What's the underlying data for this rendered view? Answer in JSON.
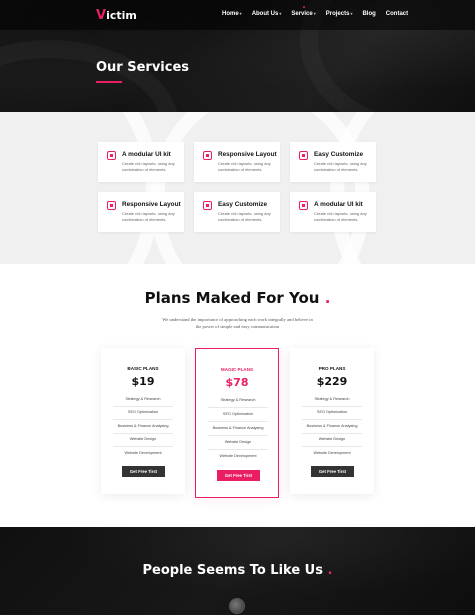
{
  "header": {
    "logo_mark": "V",
    "logo_rest": "ictim",
    "menu": [
      {
        "label": "Home",
        "caret": "▾"
      },
      {
        "label": "About Us",
        "caret": "▾"
      },
      {
        "label": "Service",
        "caret": "▾",
        "active": true
      },
      {
        "label": "Projects",
        "caret": "▾"
      },
      {
        "label": "Blog",
        "caret": ""
      },
      {
        "label": "Contact",
        "caret": ""
      }
    ],
    "page_title": "Our Services"
  },
  "features": [
    {
      "title": "A modular UI kit",
      "desc": "Create rich layouts, using any combination of elements.",
      "icon": "ui-kit-icon"
    },
    {
      "title": "Responsive Layout",
      "desc": "Create rich layouts, using any combination of elements.",
      "icon": "responsive-icon"
    },
    {
      "title": "Easy Customize",
      "desc": "Create rich layouts, using any combination of elements.",
      "icon": "customize-icon"
    },
    {
      "title": "Responsive Layout",
      "desc": "Create rich layouts, using any combination of elements.",
      "icon": "responsive-icon"
    },
    {
      "title": "Easy Customize",
      "desc": "Create rich layouts, using any combination of elements.",
      "icon": "customize-icon"
    },
    {
      "title": "A modular UI kit",
      "desc": "Create rich layouts, using any combination of elements.",
      "icon": "ui-kit-icon"
    }
  ],
  "pricing": {
    "title": "Plans Maked For You",
    "title_dot": ".",
    "subtitle": "We understand the importance of approaching each work integrally and believe in the power of simple and easy communication",
    "plans": [
      {
        "name": "BASIC PLANS",
        "price": "$19",
        "features": [
          "Strategy & Research",
          "SEO Optimization",
          "Business & Finance Analysing",
          "Website Design",
          "Website Development"
        ],
        "button": "Get Free Tirst"
      },
      {
        "name": "MAGIC PLANS",
        "price": "$78",
        "features": [
          "Strategy & Research",
          "SEO Optimization",
          "Business & Finance Analysing",
          "Website Design",
          "Website Development"
        ],
        "button": "Get Free Tirst"
      },
      {
        "name": "PRO PLANS",
        "price": "$229",
        "features": [
          "Strategy & Research",
          "SEO Optimization",
          "Business & Finance Analysing",
          "Website Design",
          "Website Development"
        ],
        "button": "Get Free Tirst"
      }
    ]
  },
  "testimonials": {
    "title": "People Seems To Like Us",
    "title_dot": "."
  },
  "colors": {
    "accent": "#e91e63",
    "dark": "#111111",
    "button_dark": "#333333"
  }
}
